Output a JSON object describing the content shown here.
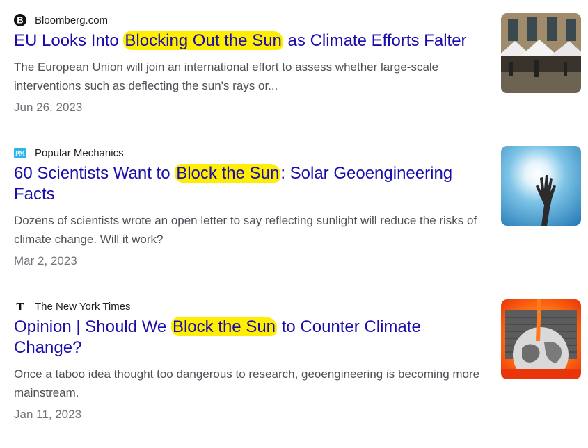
{
  "results": [
    {
      "source": "Bloomberg.com",
      "favicon_icon": "bloomberg-b-icon",
      "title_before": "EU Looks Into ",
      "title_highlight": "Blocking Out the Sun",
      "title_after": " as Climate Efforts Falter",
      "snippet": "The European Union will join an international effort to assess whether large-scale interventions such as deflecting the sun's rays or...",
      "date": "Jun 26, 2023",
      "thumbnail_icon": "street-cafe-photo"
    },
    {
      "source": "Popular Mechanics",
      "favicon_icon": "pm-logo-icon",
      "favicon_text": "PM",
      "title_before": "60 Scientists Want to ",
      "title_highlight": "Block the Sun",
      "title_after": ": Solar Geoengineering Facts",
      "snippet": "Dozens of scientists wrote an open letter to say reflecting sunlight will reduce the risks of climate change. Will it work?",
      "date": "Mar 2, 2023",
      "thumbnail_icon": "hand-blocking-sun-photo"
    },
    {
      "source": "The New York Times",
      "favicon_icon": "nyt-t-icon",
      "favicon_text": "T",
      "title_before": "Opinion | Should We ",
      "title_highlight": "Block the Sun",
      "title_after": " to Counter Climate Change?",
      "snippet": "Once a taboo idea thought too dangerous to research, geoengineering is becoming more mainstream.",
      "date": "Jan 11, 2023",
      "thumbnail_icon": "earth-wall-sun-illustration"
    }
  ],
  "colors": {
    "link": "#1a0dab",
    "highlight": "#ffee00",
    "snippet": "#4d5156",
    "date": "#70757a",
    "pm_blue": "#29b6e9"
  }
}
